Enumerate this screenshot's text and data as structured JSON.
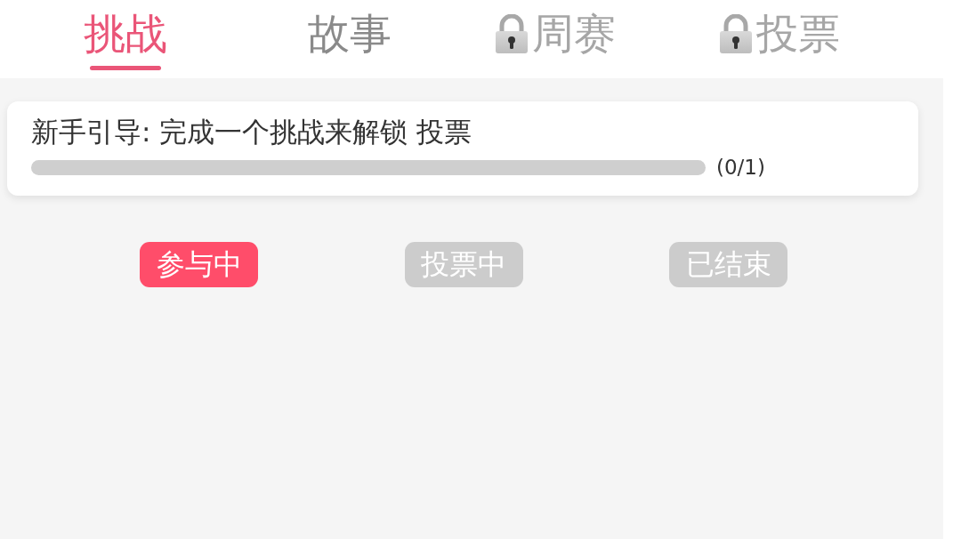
{
  "tabs": [
    {
      "label": "挑战",
      "selected": true,
      "locked": false
    },
    {
      "label": "故事",
      "selected": false,
      "locked": false
    },
    {
      "label": "周赛",
      "selected": false,
      "locked": true
    },
    {
      "label": "投票",
      "selected": false,
      "locked": true
    }
  ],
  "guide_card": {
    "title": "新手引导: 完成一个挑战来解锁 投票",
    "progress": {
      "level": 0,
      "reading": "(0/1)"
    }
  },
  "filters": [
    {
      "label": "参与中",
      "selected": true
    },
    {
      "label": "投票中",
      "selected": false
    },
    {
      "label": "已结束",
      "selected": false
    }
  ]
}
